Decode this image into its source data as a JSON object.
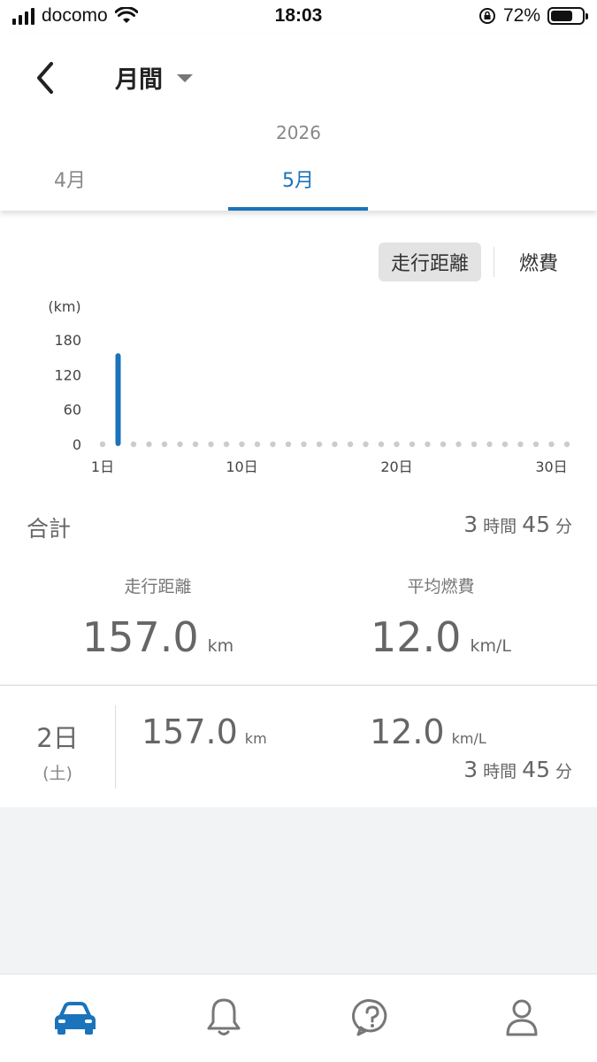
{
  "status_bar": {
    "carrier": "docomo",
    "time": "18:03",
    "battery_percent": "72%",
    "battery_level": 0.72
  },
  "header": {
    "title": "月間",
    "year": "2026",
    "tabs": [
      {
        "label": "4月",
        "selected": false
      },
      {
        "label": "5月",
        "selected": true
      }
    ]
  },
  "toggle": {
    "options": [
      {
        "label": "走行距離",
        "active": true
      },
      {
        "label": "燃費",
        "active": false
      }
    ]
  },
  "chart_data": {
    "type": "bar",
    "ylabel": "(km)",
    "yticks": [
      0,
      60,
      120,
      180
    ],
    "ylim": [
      0,
      180
    ],
    "x": [
      1,
      2,
      3,
      4,
      5,
      6,
      7,
      8,
      9,
      10,
      11,
      12,
      13,
      14,
      15,
      16,
      17,
      18,
      19,
      20,
      21,
      22,
      23,
      24,
      25,
      26,
      27,
      28,
      29,
      30,
      31
    ],
    "values": [
      0,
      157,
      0,
      0,
      0,
      0,
      0,
      0,
      0,
      0,
      0,
      0,
      0,
      0,
      0,
      0,
      0,
      0,
      0,
      0,
      0,
      0,
      0,
      0,
      0,
      0,
      0,
      0,
      0,
      0,
      0
    ],
    "xtick_labels": [
      {
        "day": 1,
        "label": "1日"
      },
      {
        "day": 10,
        "label": "10日"
      },
      {
        "day": 20,
        "label": "20日"
      },
      {
        "day": 30,
        "label": "30日"
      }
    ],
    "bar_color": "#1a73bb",
    "dot_color": "#cccccc"
  },
  "summary": {
    "label": "合計",
    "hours": "3",
    "hours_unit": "時間",
    "minutes": "45",
    "minutes_unit": "分",
    "distance_label": "走行距離",
    "distance_value": "157.0",
    "distance_unit": "km",
    "fuel_label": "平均燃費",
    "fuel_value": "12.0",
    "fuel_unit": "km/L"
  },
  "day_entry": {
    "day": "2日",
    "weekday": "(土)",
    "distance_value": "157.0",
    "distance_unit": "km",
    "fuel_value": "12.0",
    "fuel_unit": "km/L",
    "hours": "3",
    "hours_unit": "時間",
    "minutes": "45",
    "minutes_unit": "分"
  },
  "bottom_nav": [
    {
      "icon": "car-icon",
      "active": true
    },
    {
      "icon": "bell-icon",
      "active": false
    },
    {
      "icon": "help-icon",
      "active": false
    },
    {
      "icon": "user-icon",
      "active": false
    }
  ],
  "colors": {
    "accent": "#1a73bb",
    "inactive_icon": "#777777"
  }
}
